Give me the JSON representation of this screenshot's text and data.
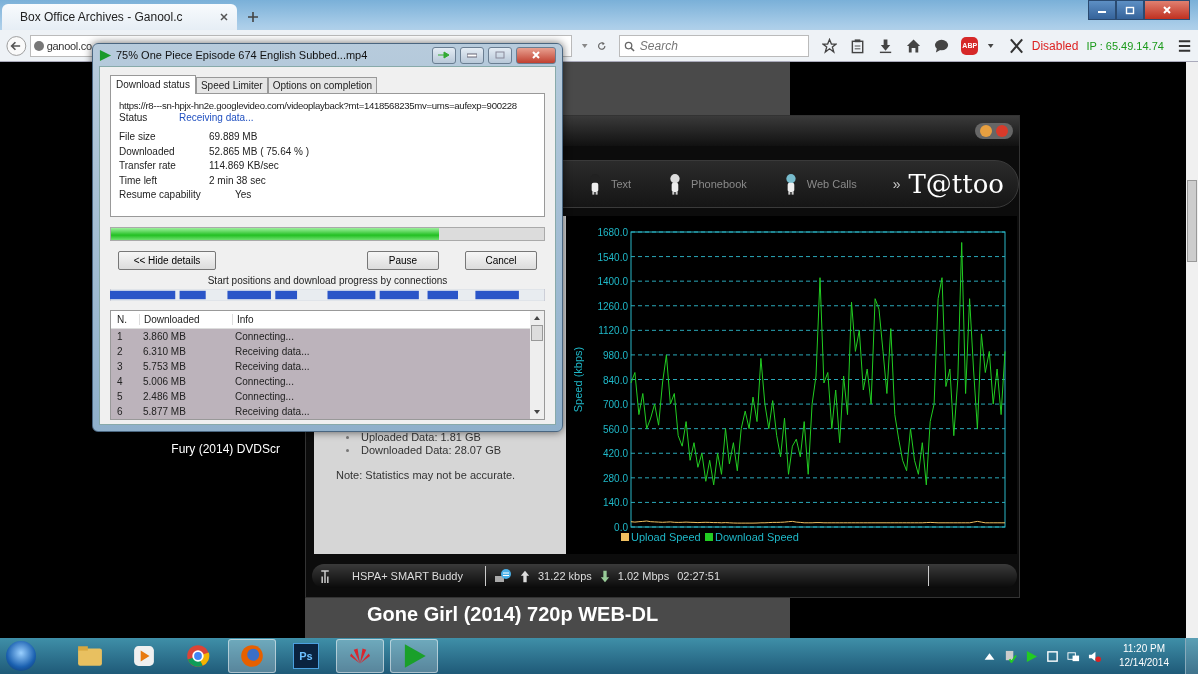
{
  "browser": {
    "tab_title": "Box Office Archives - Ganool.c",
    "address": "ganool.co",
    "search_placeholder": "Search",
    "addon_badge": "ABP",
    "proxy_status": "Disabled",
    "ip": "IP : 65.49.14.74"
  },
  "page": {
    "items": [
      "Fury (2014) DVDScr",
      "Gone Girl (2014) 720p WEB-DL"
    ]
  },
  "tattoo": {
    "nav": [
      {
        "label": "Text"
      },
      {
        "label": "Phonebook"
      },
      {
        "label": "Web Calls"
      }
    ],
    "more": "»",
    "logo": "T@ttoo",
    "stats": [
      "Uploaded Data: 1.81 GB",
      "Downloaded Data: 28.07 GB"
    ],
    "note": "Note: Statistics may not be accurate.",
    "chart_data": {
      "type": "line",
      "ylabel": "Speed (kbps)",
      "ylim": [
        0,
        1680
      ],
      "grid": true,
      "legend": true,
      "yticks": [
        {
          "value": 0,
          "label": "0.0"
        },
        {
          "value": 140,
          "label": "140.0"
        },
        {
          "value": 280,
          "label": "280.0"
        },
        {
          "value": 420,
          "label": "420.0"
        },
        {
          "value": 560,
          "label": "560.0"
        },
        {
          "value": 700,
          "label": "700.0"
        },
        {
          "value": 840,
          "label": "840.0"
        },
        {
          "value": 980,
          "label": "980.0"
        },
        {
          "value": 1120,
          "label": "1120.0"
        },
        {
          "value": 1260,
          "label": "1260.0"
        },
        {
          "value": 1400,
          "label": "1400.0"
        },
        {
          "value": 1540,
          "label": "1540.0"
        },
        {
          "value": 1680,
          "label": "1680.0"
        }
      ],
      "series": [
        {
          "name": "Upload Speed",
          "color": "#f0c060",
          "values": [
            30,
            28,
            30,
            32,
            34,
            30,
            29,
            28,
            27,
            28,
            29,
            27,
            26,
            27,
            28,
            27,
            26,
            25,
            26,
            27,
            26,
            25,
            25,
            24,
            25,
            24,
            23,
            22,
            22,
            22,
            22,
            22,
            23,
            24,
            24,
            25,
            26,
            26,
            27,
            28,
            30,
            32,
            28,
            26,
            24,
            24,
            24,
            25,
            25,
            24,
            24,
            24,
            24,
            24,
            24,
            24,
            24,
            24,
            24,
            24,
            24,
            24,
            24,
            24,
            24,
            24,
            24,
            24,
            24,
            24,
            24,
            24,
            24,
            24,
            24,
            25,
            26,
            25,
            24,
            24,
            24,
            24,
            24,
            24,
            24,
            24,
            24,
            28,
            32,
            28,
            24,
            24,
            24,
            24,
            24,
            24
          ]
        },
        {
          "name": "Download Speed",
          "color": "#22cc22",
          "values": [
            820,
            880,
            640,
            760,
            560,
            620,
            700,
            580,
            820,
            980,
            700,
            760,
            520,
            460,
            600,
            380,
            480,
            340,
            420,
            260,
            380,
            240,
            420,
            300,
            560,
            360,
            480,
            320,
            560,
            660,
            560,
            740,
            600,
            960,
            700,
            560,
            720,
            520,
            400,
            620,
            300,
            460,
            500,
            400,
            600,
            300,
            700,
            860,
            1420,
            820,
            880,
            560,
            780,
            480,
            860,
            640,
            1280,
            1000,
            1120,
            780,
            900,
            700,
            1300,
            1240,
            1000,
            760,
            1130,
            640,
            500,
            380,
            320,
            560,
            380,
            300,
            480,
            240,
            600,
            700,
            1300,
            1420,
            800,
            900,
            520,
            840,
            1620,
            760,
            1300,
            900,
            560,
            1100,
            880,
            1000,
            700,
            900,
            640,
            1000
          ]
        }
      ]
    },
    "status": {
      "network": "HSPA+ SMART Buddy",
      "upload": "31.22 kbps",
      "download": "1.02 Mbps",
      "duration": "02:27:51"
    }
  },
  "download_dialog": {
    "title": "75% One Piece Episode 674 English Subbed...mp4",
    "tabs": [
      {
        "label": "Download status",
        "selected": true
      },
      {
        "label": "Speed Limiter",
        "selected": false
      },
      {
        "label": "Options on completion",
        "selected": false
      }
    ],
    "url": "https://r8---sn-hpjx-hn2e.googlevideo.com/videoplayback?mt=1418568235mv=ums=aufexp=900228",
    "status_label": "Status",
    "status_value": "Receiving data...",
    "fields": [
      {
        "label": "File size",
        "value": "69.889  MB"
      },
      {
        "label": "Downloaded",
        "value": "52.865  MB  ( 75.64 % )"
      },
      {
        "label": "Transfer rate",
        "value": "114.869  KB/sec"
      },
      {
        "label": "Time left",
        "value": "2 min 38 sec"
      },
      {
        "label": "Resume capability",
        "value": "Yes"
      }
    ],
    "progress": {
      "level": 0.7564
    },
    "buttons": {
      "details": "<< Hide details",
      "pause": "Pause",
      "cancel": "Cancel"
    },
    "connections_caption": "Start positions and download progress by connections",
    "columns": [
      "N.",
      "Downloaded",
      "Info"
    ],
    "rows": [
      {
        "n": "1",
        "downloaded": "3.860  MB",
        "info": "Connecting..."
      },
      {
        "n": "2",
        "downloaded": "6.310  MB",
        "info": "Receiving data..."
      },
      {
        "n": "3",
        "downloaded": "5.753  MB",
        "info": "Receiving data..."
      },
      {
        "n": "4",
        "downloaded": "5.006  MB",
        "info": "Connecting..."
      },
      {
        "n": "5",
        "downloaded": "2.486  MB",
        "info": "Connecting..."
      },
      {
        "n": "6",
        "downloaded": "5.877  MB",
        "info": "Receiving data..."
      }
    ]
  },
  "taskbar": {
    "apps": [
      {
        "kind": "explorer",
        "active": false
      },
      {
        "kind": "media",
        "active": false
      },
      {
        "kind": "chrome",
        "active": false
      },
      {
        "kind": "firefox",
        "active": true
      },
      {
        "kind": "photoshop",
        "active": false,
        "label": "Ps"
      },
      {
        "kind": "huawei",
        "active": true
      },
      {
        "kind": "idm",
        "active": true
      }
    ],
    "time": "11:20 PM",
    "date": "12/14/2014"
  }
}
